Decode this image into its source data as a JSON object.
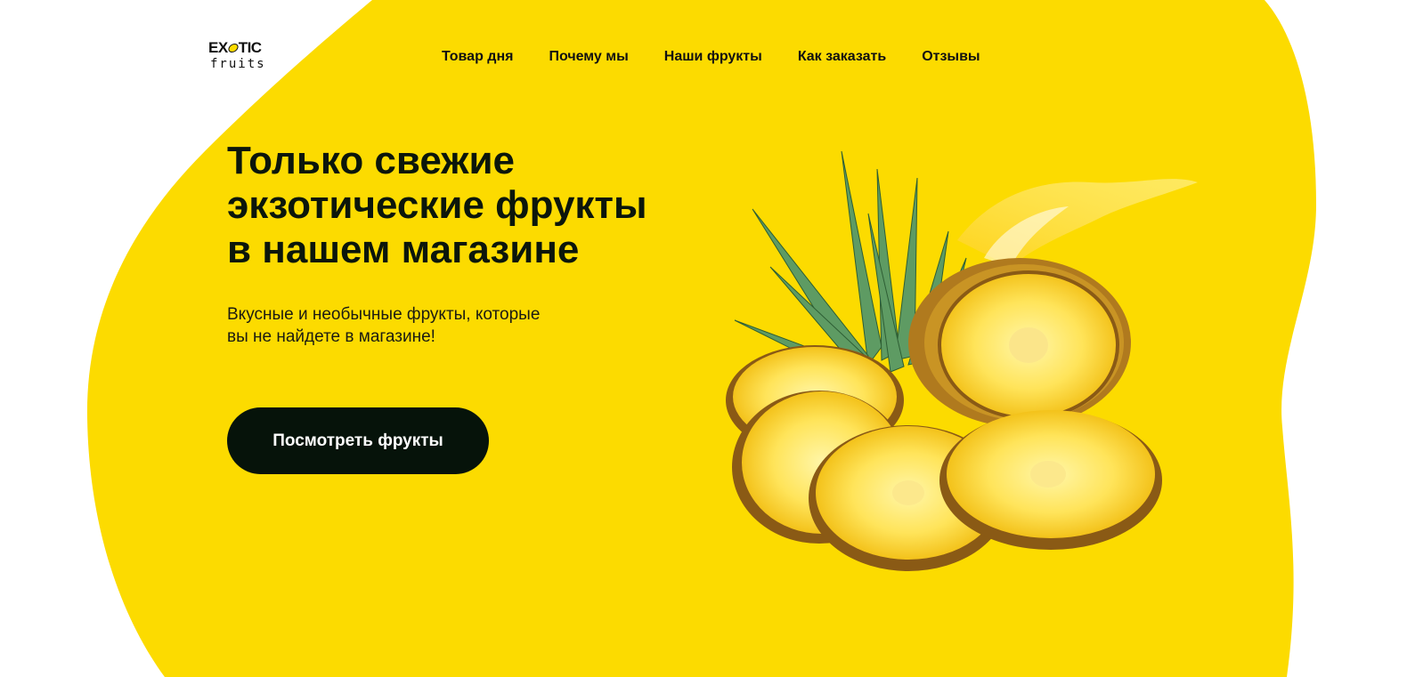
{
  "colors": {
    "accent_yellow": "#FCDB00",
    "button_bg": "#06130A",
    "text_dark": "#0B160B"
  },
  "logo": {
    "top_left": "EX",
    "top_right": "TIC",
    "bottom": "fruits",
    "icon": "lemon-icon"
  },
  "nav": {
    "items": [
      {
        "label": "Товар дня"
      },
      {
        "label": "Почему мы"
      },
      {
        "label": "Наши фрукты"
      },
      {
        "label": "Как заказать"
      },
      {
        "label": "Отзывы"
      }
    ]
  },
  "hero": {
    "title_lines": [
      "Только свежие",
      "экзотические фрукты",
      "в нашем магазине"
    ],
    "subtitle_lines": [
      "Вкусные и необычные фрукты, которые",
      "вы не найдете в магазине!"
    ],
    "cta_label": "Посмотреть фрукты",
    "image": "pineapple-slices-image"
  }
}
